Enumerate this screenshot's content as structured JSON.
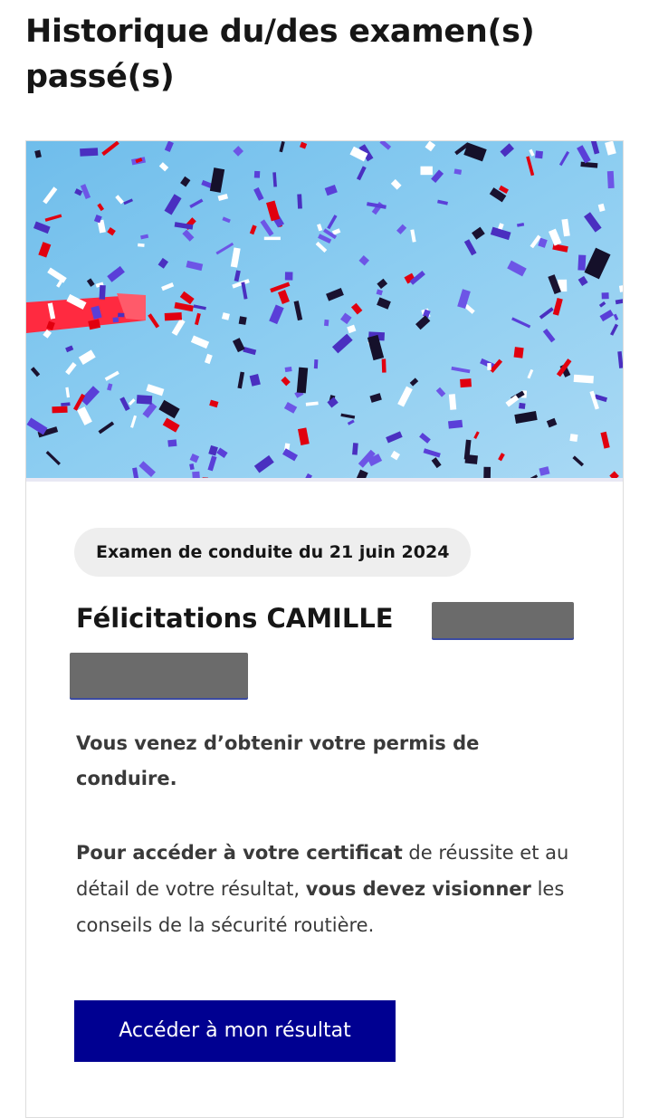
{
  "page": {
    "title": "Historique du/des examen(s) passé(s)"
  },
  "card": {
    "image_description_icon": "confetti-image",
    "badge": "Examen de conduite du 21 juin 2024",
    "greeting": "Félicitations CAMILLE",
    "lead": "Vous venez d’obtenir votre permis de conduire.",
    "info": {
      "part1_bold": "Pour accéder à votre certificat",
      "part2": " de réussite et au détail de votre résultat, ",
      "part3_bold": "vous devez visionner",
      "part4": " les conseils de la sécurité routière."
    },
    "button_label": "Accéder à mon résultat"
  },
  "colors": {
    "primary": "#000091",
    "sky": "#7cc4ee",
    "confetti_red": "#e1000f",
    "confetti_blue": "#5a3fd8",
    "badge_bg": "#eeeeee"
  }
}
